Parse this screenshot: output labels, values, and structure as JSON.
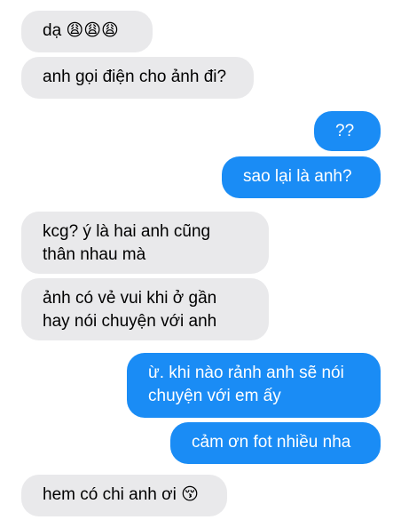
{
  "colors": {
    "received_bubble": "#e9e9eb",
    "sent_bubble": "#1a8cf5",
    "received_text": "#000000",
    "sent_text": "#ffffff"
  },
  "messages": [
    {
      "side": "received",
      "lines": [
        "dạ 😩😩😩"
      ]
    },
    {
      "side": "received",
      "lines": [
        "anh gọi điện cho ảnh đi?"
      ]
    },
    {
      "side": "sent",
      "lines": [
        "??"
      ]
    },
    {
      "side": "sent",
      "lines": [
        "sao lại là anh?"
      ]
    },
    {
      "side": "received",
      "lines": [
        "kcg? ý là hai anh cũng",
        "thân nhau mà"
      ]
    },
    {
      "side": "received",
      "lines": [
        "ảnh có vẻ vui khi ở gần",
        "hay nói chuyện với anh"
      ]
    },
    {
      "side": "sent",
      "lines": [
        "ừ. khi nào rảnh anh sẽ nói",
        "chuyện với em ấy"
      ]
    },
    {
      "side": "sent",
      "lines": [
        "cảm ơn fot nhiều nha"
      ]
    },
    {
      "side": "received",
      "lines": [
        "hem có chi anh ơi 😚"
      ]
    }
  ]
}
